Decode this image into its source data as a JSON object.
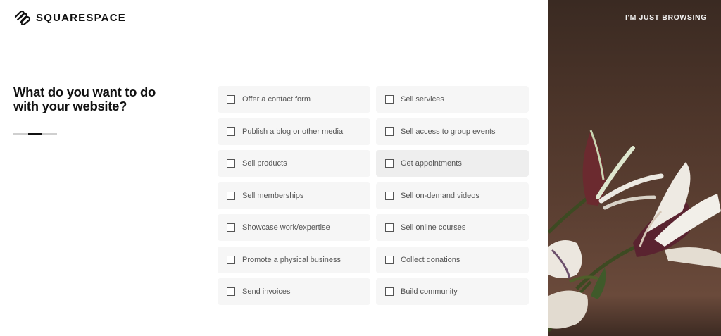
{
  "brand": {
    "name": "SQUARESPACE",
    "icon": "squarespace-logo-icon"
  },
  "question": {
    "title": "What do you want to do with your website?"
  },
  "progress": {
    "fraction": 0.33
  },
  "options": [
    {
      "label": "Offer a contact form"
    },
    {
      "label": "Sell services"
    },
    {
      "label": "Publish a blog or other media"
    },
    {
      "label": "Sell access to group events"
    },
    {
      "label": "Sell products"
    },
    {
      "label": "Get appointments"
    },
    {
      "label": "Sell memberships"
    },
    {
      "label": "Sell on-demand videos"
    },
    {
      "label": "Showcase work/expertise"
    },
    {
      "label": "Sell online courses"
    },
    {
      "label": "Promote a physical business"
    },
    {
      "label": "Collect donations"
    },
    {
      "label": "Send invoices"
    },
    {
      "label": "Build community"
    }
  ],
  "header": {
    "browse_label": "I'M JUST BROWSING"
  },
  "colors": {
    "panel_bg": "#4b3429",
    "option_bg": "#f6f6f6",
    "text": "#111111"
  }
}
